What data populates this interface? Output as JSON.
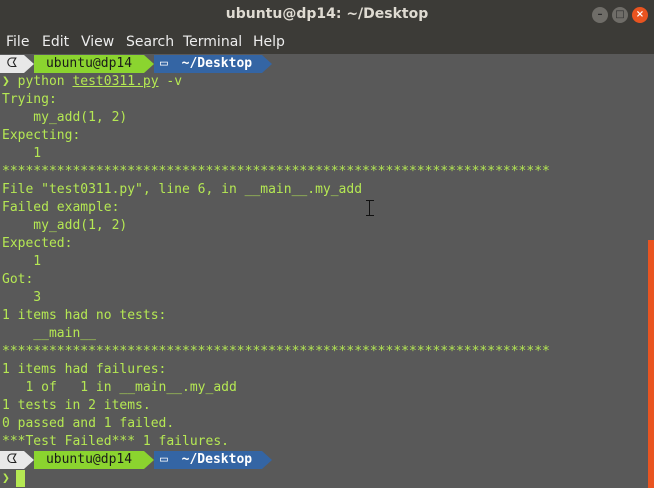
{
  "window": {
    "title": "ubuntu@dp14: ~/Desktop"
  },
  "menubar": {
    "items": [
      "File",
      "Edit",
      "View",
      "Search",
      "Terminal",
      "Help"
    ]
  },
  "prompt": {
    "os_glyph": "ᗧ",
    "user_host": "ubuntu@dp14",
    "dir_glyph": "▭",
    "dir": "~/Desktop",
    "caret": "❯"
  },
  "command": {
    "program": "python",
    "file": "test0311.py",
    "flag": "-v"
  },
  "output": [
    "Trying:",
    "    my_add(1, 2)",
    "Expecting:",
    "    1",
    "**********************************************************************",
    "File \"test0311.py\", line 6, in __main__.my_add",
    "Failed example:",
    "    my_add(1, 2)",
    "Expected:",
    "    1",
    "Got:",
    "    3",
    "1 items had no tests:",
    "    __main__",
    "**********************************************************************",
    "1 items had failures:",
    "   1 of   1 in __main__.my_add",
    "1 tests in 2 items.",
    "0 passed and 1 failed.",
    "***Test Failed*** 1 failures."
  ],
  "colors": {
    "terminal_bg": "#595959",
    "text": "#b5e853",
    "accent": "#e95420",
    "dir_bg": "#3465a4",
    "user_bg": "#8bd42f"
  }
}
